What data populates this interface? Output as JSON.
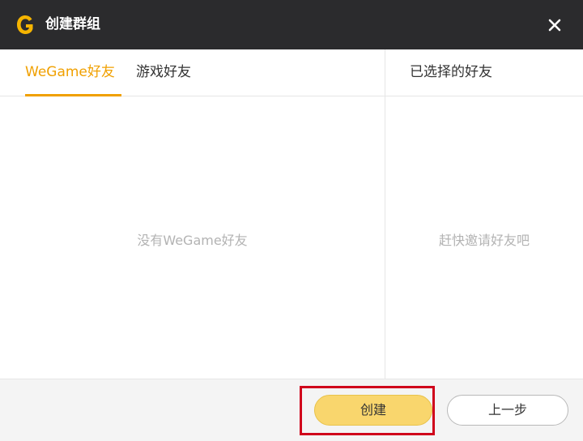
{
  "window": {
    "title": "创建群组",
    "close_icon": "close-icon",
    "logo_icon": "wegame-logo-icon"
  },
  "tabs": [
    {
      "label": "WeGame好友",
      "active": true
    },
    {
      "label": "游戏好友",
      "active": false
    }
  ],
  "selected_panel": {
    "title": "已选择的好友",
    "empty_text": "赶快邀请好友吧"
  },
  "friends_panel": {
    "empty_text": "没有WeGame好友"
  },
  "footer": {
    "create_label": "创建",
    "prev_label": "上一步"
  },
  "colors": {
    "accent": "#f0a000",
    "titlebar": "#2b2b2d",
    "create_button": "#f9d66d",
    "highlight": "#d0021b"
  }
}
